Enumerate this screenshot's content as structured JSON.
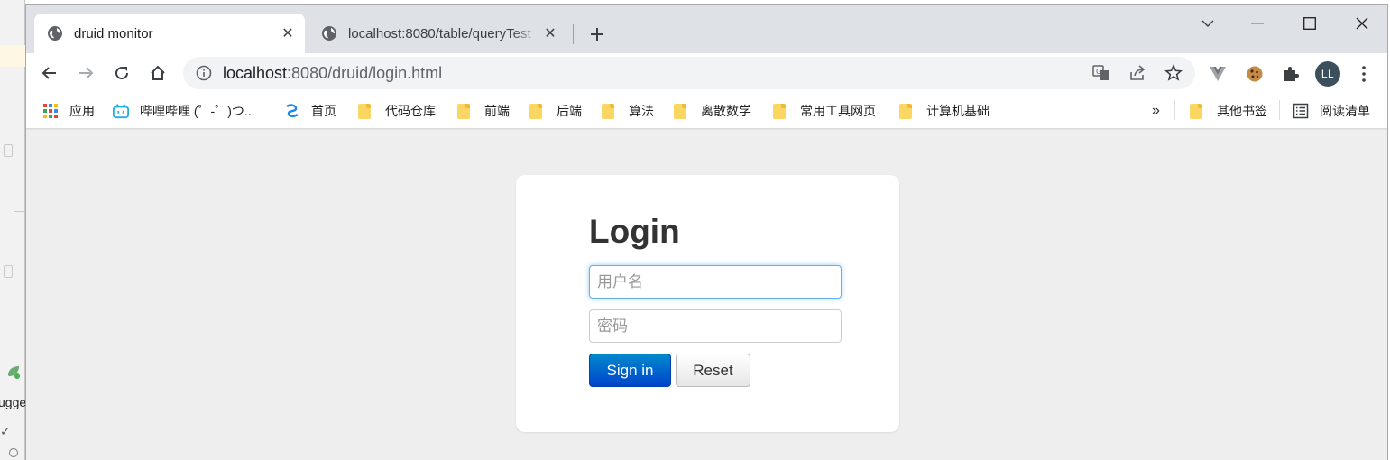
{
  "window": {
    "tabs": [
      {
        "title": "druid monitor",
        "active": true
      },
      {
        "title": "localhost:8080/table/queryTest",
        "active": false
      }
    ]
  },
  "toolbar": {
    "url_host": "localhost",
    "url_rest": ":8080/druid/login.html"
  },
  "bookmarks": {
    "items": [
      {
        "label": "应用",
        "icon": "apps-grid-icon"
      },
      {
        "label": "哔哩哔哩 (゜-゜)つ...",
        "icon": "bilibili-icon"
      },
      {
        "label": "首页",
        "icon": "site-icon"
      },
      {
        "label": "代码仓库",
        "icon": "folder-icon"
      },
      {
        "label": "前端",
        "icon": "folder-icon"
      },
      {
        "label": "后端",
        "icon": "folder-icon"
      },
      {
        "label": "算法",
        "icon": "folder-icon"
      },
      {
        "label": "离散数学",
        "icon": "folder-icon"
      },
      {
        "label": "常用工具网页",
        "icon": "folder-icon"
      },
      {
        "label": "计算机基础",
        "icon": "folder-icon"
      }
    ],
    "overflow": "»",
    "other": "其他书签",
    "reading_list": "阅读清单"
  },
  "profile": {
    "initials": "LL"
  },
  "page": {
    "title": "Login",
    "username_placeholder": "用户名",
    "password_placeholder": "密码",
    "signin_label": "Sign in",
    "reset_label": "Reset"
  },
  "background_app": {
    "partial_text": "ugge"
  },
  "colors": {
    "primary_button": "#0055cc",
    "focus_ring": "#52a8ec",
    "page_background": "#eeeeee"
  }
}
